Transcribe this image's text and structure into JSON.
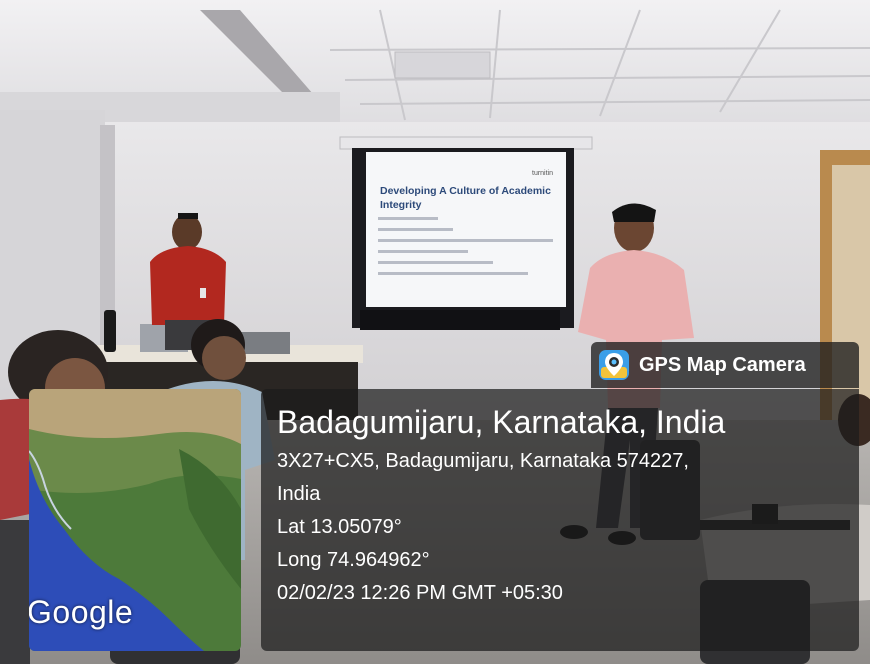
{
  "colors": {
    "overlay_background": "#1c1c1c",
    "overlay_text": "#ffffff",
    "slide_title": "#2d4a7a",
    "shirt_red": "#b2281f",
    "shirt_pink": "#eab0b0",
    "map_ocean": "#2d4db8",
    "map_land": "#4d7a3a"
  },
  "slide": {
    "brand_text": "turnitin",
    "title_line1": "Developing A Culture of Academic",
    "title_line2": "Integrity"
  },
  "overlay": {
    "app_icon": "gps-map-camera-icon",
    "app_name": "GPS Map Camera",
    "place_title": "Badagumijaru, Karnataka, India",
    "address_line1": "3X27+CX5, Badagumijaru, Karnataka 574227,",
    "address_line2": "India",
    "latitude": "Lat 13.05079°",
    "longitude": "Long 74.964962°",
    "timestamp": "02/02/23 12:26 PM GMT +05:30"
  },
  "map": {
    "provider_logo": "Google"
  }
}
